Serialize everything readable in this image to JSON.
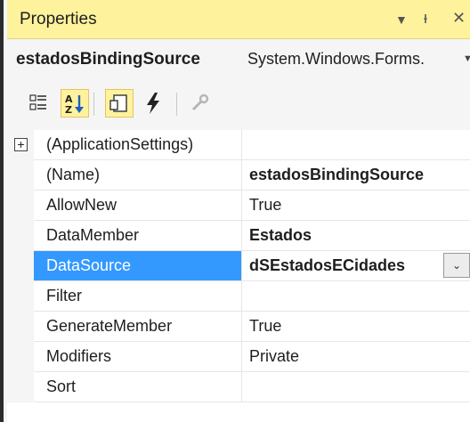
{
  "window": {
    "title": "Properties",
    "dropdown_icon": "dropdown-arrow-icon",
    "pin_icon": "pin-icon",
    "close_icon": "close-icon",
    "dropdown_glyph": "▼",
    "pin_glyph": "ᵻ",
    "close_glyph": "✕"
  },
  "object_selector": {
    "name": "estadosBindingSource",
    "type": "System.Windows.Forms.",
    "dropdown_glyph": "▼"
  },
  "toolbar": {
    "buttons": [
      {
        "icon": "categorized-icon",
        "active": false
      },
      {
        "icon": "alphabetical-icon",
        "active": true
      },
      {
        "icon": "properties-icon",
        "active": true
      },
      {
        "icon": "events-icon",
        "active": false
      },
      {
        "icon": "property-pages-icon",
        "active": false,
        "disabled": true
      }
    ]
  },
  "grid": {
    "rows": [
      {
        "name": "(ApplicationSettings)",
        "value": "",
        "expandable": true,
        "expand_glyph": "+"
      },
      {
        "name": "(Name)",
        "value": "estadosBindingSource",
        "bold": true
      },
      {
        "name": "AllowNew",
        "value": "True"
      },
      {
        "name": "DataMember",
        "value": "Estados",
        "bold": true
      },
      {
        "name": "DataSource",
        "value": "dSEstadosECidades",
        "bold": true,
        "selected": true,
        "combo_glyph": "⌄"
      },
      {
        "name": "Filter",
        "value": ""
      },
      {
        "name": "GenerateMember",
        "value": "True"
      },
      {
        "name": "Modifiers",
        "value": "Private"
      },
      {
        "name": "Sort",
        "value": ""
      }
    ]
  },
  "colors": {
    "title_bar": "#fff29d",
    "selection": "#3399ff",
    "border_dark": "#2b2b2b"
  }
}
